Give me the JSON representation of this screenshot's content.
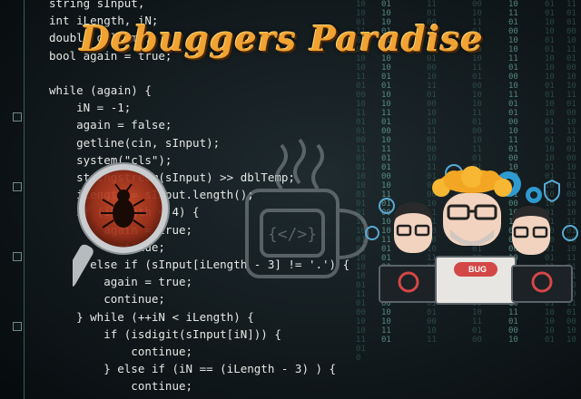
{
  "banner": {
    "title": "Debuggers Paradise",
    "colors": {
      "title_fill": "#f0a232",
      "title_shadow": "#4a2605",
      "background": "#121a1d",
      "code_text": "#e6e8e4"
    }
  },
  "code_lines": [
    "string sInput,",
    "int iLength, iN;",
    "double dblTemp;",
    "bool again = true;",
    "",
    "while (again) {",
    "    iN = -1;",
    "    again = false;",
    "    getline(cin, sInput);",
    "    system(\"cls\");",
    "    stringstream(sInput) >> dblTemp;",
    "    iLength = sInput.length();",
    "    if (iLength < 4) {",
    "        again = true;",
    "        continue;",
    "    } else if (sInput[iLength - 3] != '.') {",
    "        again = true;",
    "        continue;",
    "    } while (++iN < iLength) {",
    "        if (isdigit(sInput[iN])) {",
    "            continue;",
    "        } else if (iN == (iLength - 3) ) {",
    "            continue;"
  ],
  "illustration": {
    "bug_label": "BUG",
    "icons": [
      "magnifier-bug-icon",
      "coffee-mug-icon",
      "gear-icon",
      "shield-icon",
      "code-bubble-icon",
      "laptop-icon"
    ]
  }
}
